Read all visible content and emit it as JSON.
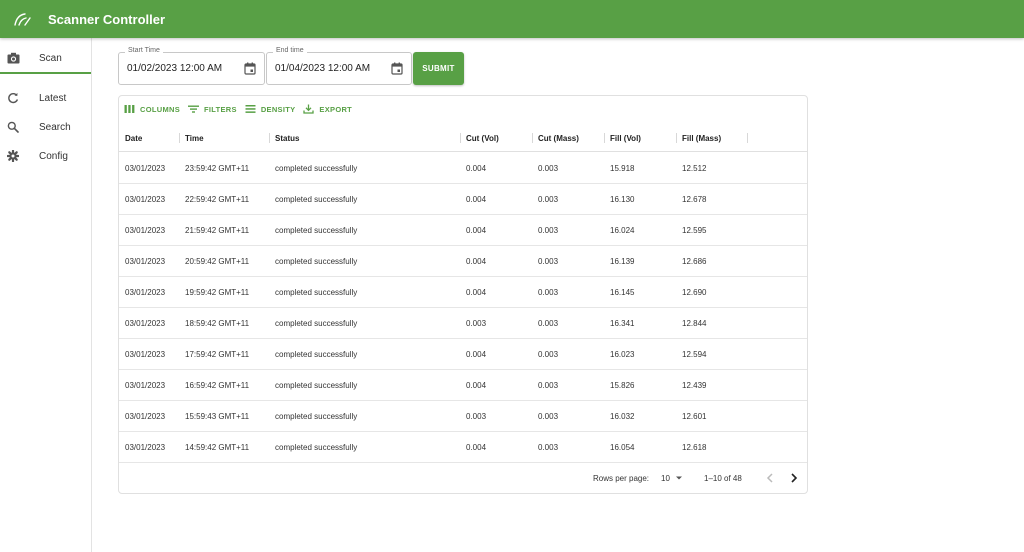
{
  "app": {
    "title": "Scanner Controller"
  },
  "sidebar": {
    "items": [
      {
        "label": "Scan",
        "icon": "camera-icon",
        "active": true
      },
      {
        "label": "Latest",
        "icon": "refresh-icon"
      },
      {
        "label": "Search",
        "icon": "search-icon"
      },
      {
        "label": "Config",
        "icon": "gear-icon"
      }
    ]
  },
  "filters": {
    "start": {
      "label": "Start Time",
      "value": "01/02/2023 12:00 AM"
    },
    "end": {
      "label": "End time",
      "value": "01/04/2023 12:00 AM"
    },
    "submit_label": "SUBMIT"
  },
  "toolbar": {
    "columns": "COLUMNS",
    "filters": "FILTERS",
    "density": "DENSITY",
    "export": "EXPORT"
  },
  "table": {
    "headers": [
      "Date",
      "Time",
      "Status",
      "Cut (Vol)",
      "Cut (Mass)",
      "Fill (Vol)",
      "Fill (Mass)"
    ],
    "rows": [
      [
        "03/01/2023",
        "23:59:42 GMT+11",
        "completed successfully",
        "0.004",
        "0.003",
        "15.918",
        "12.512"
      ],
      [
        "03/01/2023",
        "22:59:42 GMT+11",
        "completed successfully",
        "0.004",
        "0.003",
        "16.130",
        "12.678"
      ],
      [
        "03/01/2023",
        "21:59:42 GMT+11",
        "completed successfully",
        "0.004",
        "0.003",
        "16.024",
        "12.595"
      ],
      [
        "03/01/2023",
        "20:59:42 GMT+11",
        "completed successfully",
        "0.004",
        "0.003",
        "16.139",
        "12.686"
      ],
      [
        "03/01/2023",
        "19:59:42 GMT+11",
        "completed successfully",
        "0.004",
        "0.003",
        "16.145",
        "12.690"
      ],
      [
        "03/01/2023",
        "18:59:42 GMT+11",
        "completed successfully",
        "0.003",
        "0.003",
        "16.341",
        "12.844"
      ],
      [
        "03/01/2023",
        "17:59:42 GMT+11",
        "completed successfully",
        "0.004",
        "0.003",
        "16.023",
        "12.594"
      ],
      [
        "03/01/2023",
        "16:59:42 GMT+11",
        "completed successfully",
        "0.004",
        "0.003",
        "15.826",
        "12.439"
      ],
      [
        "03/01/2023",
        "15:59:43 GMT+11",
        "completed successfully",
        "0.003",
        "0.003",
        "16.032",
        "12.601"
      ],
      [
        "03/01/2023",
        "14:59:42 GMT+11",
        "completed successfully",
        "0.004",
        "0.003",
        "16.054",
        "12.618"
      ]
    ]
  },
  "pagination": {
    "rows_per_page_label": "Rows per page:",
    "rows_per_page": "10",
    "range": "1–10 of 48"
  },
  "colors": {
    "primary": "#58a045",
    "text": "#333333",
    "border": "#e0e0e0"
  }
}
